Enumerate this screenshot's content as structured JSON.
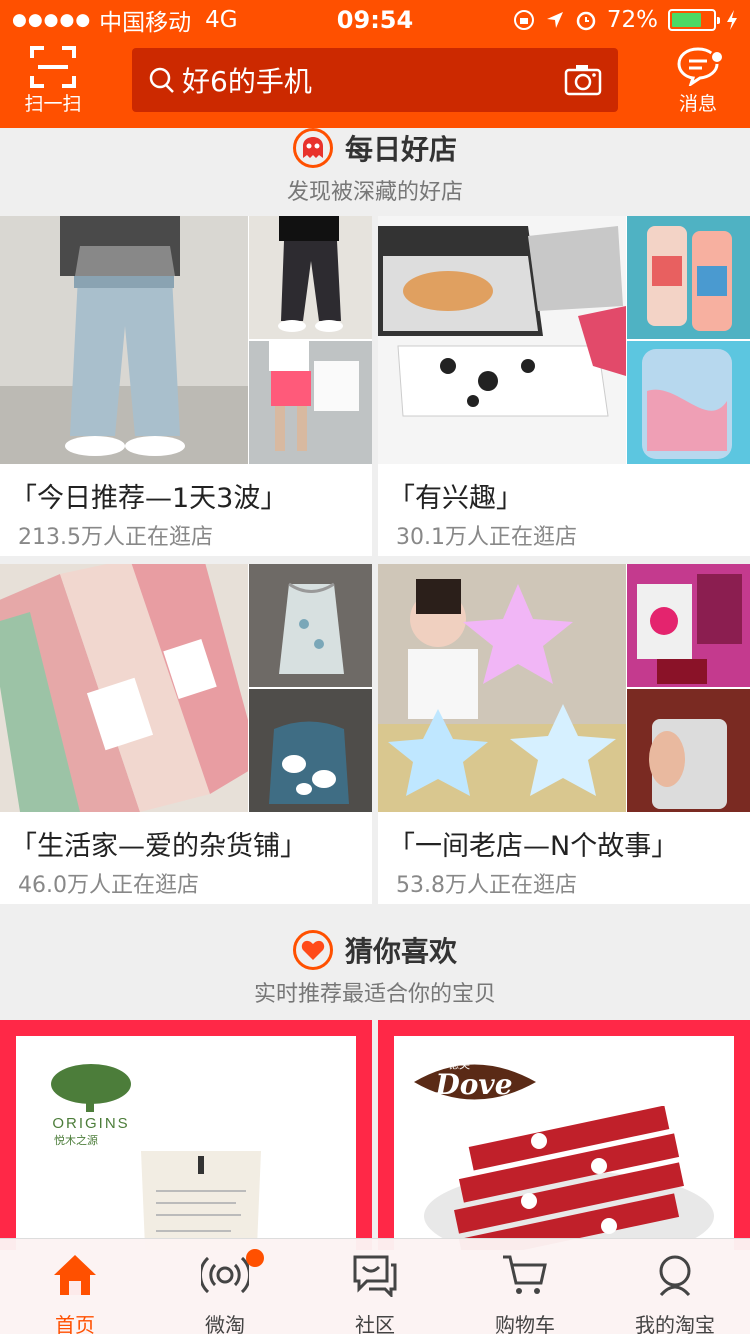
{
  "status": {
    "carrier": "中国移动",
    "network": "4G",
    "time": "09:54",
    "battery": "72%",
    "battery_level": 0.72
  },
  "header": {
    "scan_label": "扫一扫",
    "search_text": "好6的手机",
    "message_label": "消息"
  },
  "daily_shops": {
    "title": "每日好店",
    "subtitle": "发现被深藏的好店",
    "shops": [
      {
        "name": "「今日推荐—1天3波」",
        "visits": "213.5万人正在逛店"
      },
      {
        "name": "「有兴趣」",
        "visits": "30.1万人正在逛店"
      },
      {
        "name": "「生活家—爱的杂货铺」",
        "visits": "46.0万人正在逛店"
      },
      {
        "name": "「一间老店—N个故事」",
        "visits": "53.8万人正在逛店"
      }
    ]
  },
  "guess": {
    "title": "猜你喜欢",
    "subtitle": "实时推荐最适合你的宝贝",
    "item1_brand": "ORIGINS",
    "item1_brand_cn": "悦木之源",
    "item2_brand": "Dove",
    "item2_brand_cn": "德芙"
  },
  "tabs": [
    "首页",
    "微淘",
    "社区",
    "购物车",
    "我的淘宝"
  ],
  "colors": {
    "brand": "#ff5000",
    "card_red": "#ff2847"
  }
}
